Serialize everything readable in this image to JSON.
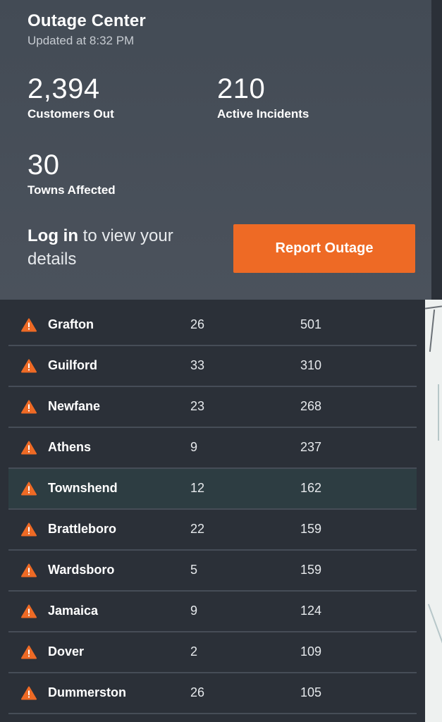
{
  "header": {
    "title": "Outage Center",
    "updated": "Updated at 8:32 PM"
  },
  "stats": {
    "customers_out": {
      "value": "2,394",
      "label": "Customers Out"
    },
    "active_incidents": {
      "value": "210",
      "label": "Active Incidents"
    },
    "towns_affected": {
      "value": "30",
      "label": "Towns Affected"
    }
  },
  "login": {
    "link_label": "Log in",
    "suffix": " to view your details"
  },
  "report_button_label": "Report Outage",
  "colors": {
    "accent": "#ee6a25",
    "header_bg": "#474f59",
    "list_bg": "#2b3038",
    "highlight_row": "#2d3d42"
  },
  "icons": {
    "row_icon": "warning-triangle-icon"
  },
  "towns": [
    {
      "name": "Grafton",
      "incidents": "26",
      "customers": "501"
    },
    {
      "name": "Guilford",
      "incidents": "33",
      "customers": "310"
    },
    {
      "name": "Newfane",
      "incidents": "23",
      "customers": "268"
    },
    {
      "name": "Athens",
      "incidents": "9",
      "customers": "237"
    },
    {
      "name": "Townshend",
      "incidents": "12",
      "customers": "162",
      "highlighted": true
    },
    {
      "name": "Brattleboro",
      "incidents": "22",
      "customers": "159"
    },
    {
      "name": "Wardsboro",
      "incidents": "5",
      "customers": "159"
    },
    {
      "name": "Jamaica",
      "incidents": "9",
      "customers": "124"
    },
    {
      "name": "Dover",
      "incidents": "2",
      "customers": "109"
    },
    {
      "name": "Dummerston",
      "incidents": "26",
      "customers": "105"
    }
  ]
}
